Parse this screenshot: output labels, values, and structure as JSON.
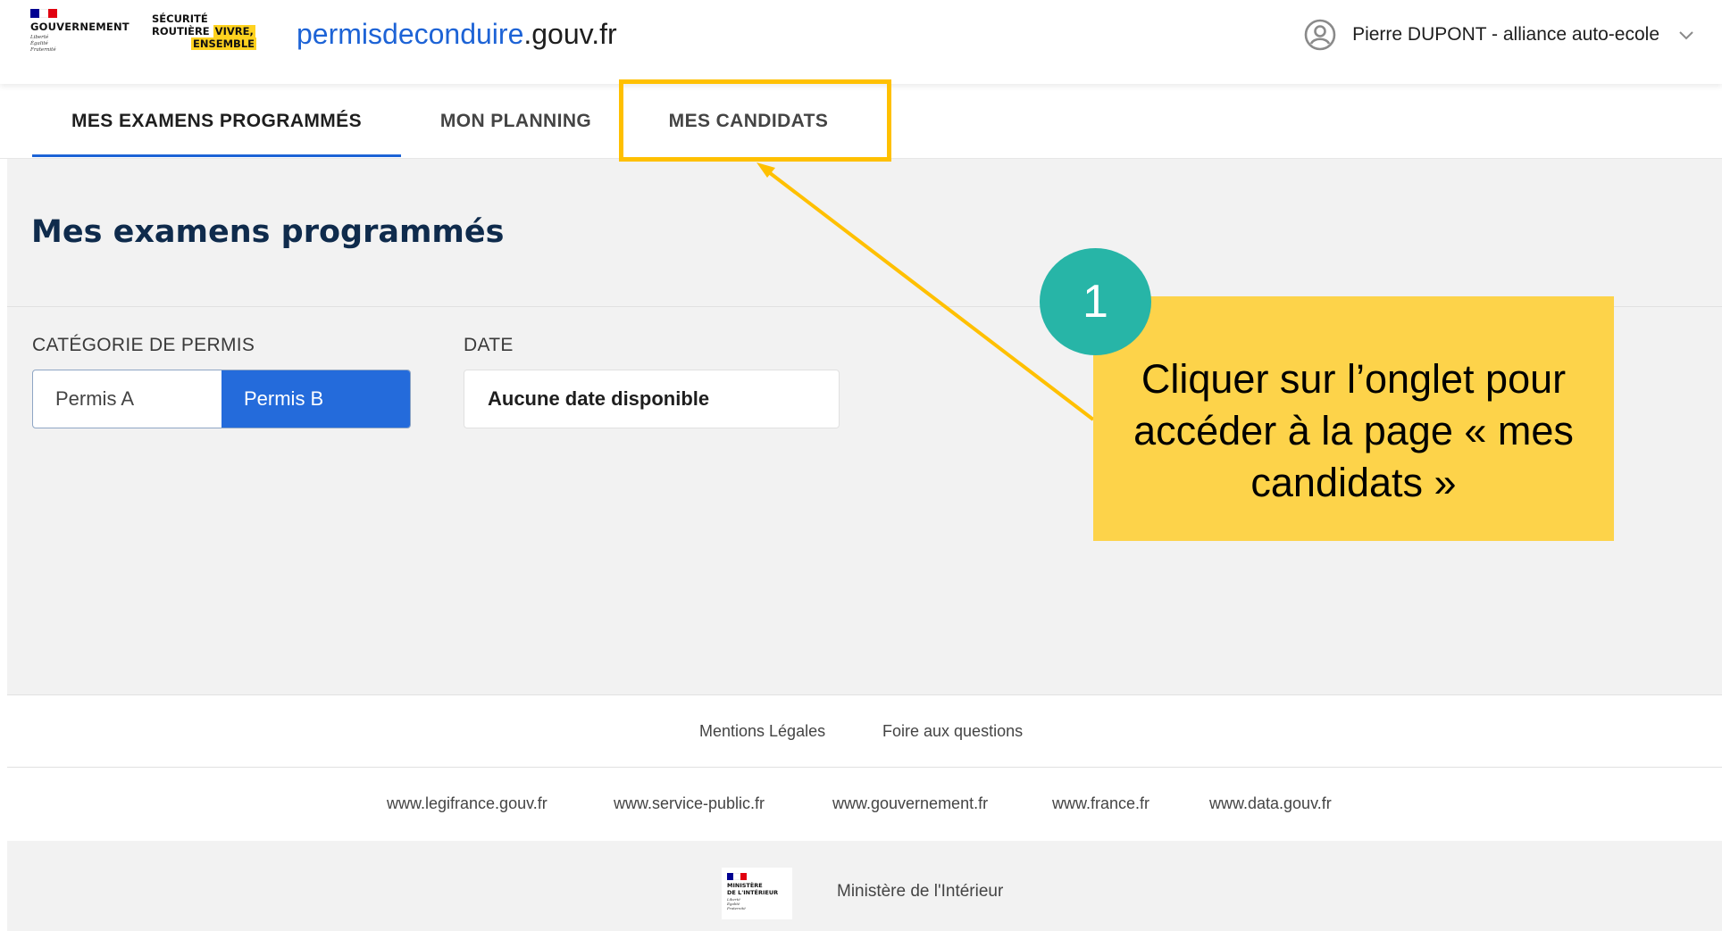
{
  "header": {
    "gov_logo_text": "GOUVERNEMENT",
    "gov_devise": [
      "Liberté",
      "Égalité",
      "Fraternité"
    ],
    "sr_logo": {
      "line1": "SÉCURITÉ",
      "line2a": "ROUTIÈRE ",
      "line2b": "VIVRE,",
      "line3": "ENSEMBLE"
    },
    "site_name_main": "permisdeconduire",
    "site_name_tld": ".gouv.fr",
    "user_label": "Pierre DUPONT - alliance auto-ecole"
  },
  "tabs": [
    {
      "label": "MES EXAMENS PROGRAMMÉS",
      "active": true
    },
    {
      "label": "MON PLANNING",
      "active": false
    },
    {
      "label": "MES CANDIDATS",
      "active": false
    }
  ],
  "main": {
    "title": "Mes examens programmés",
    "category_label": "CATÉGORIE DE PERMIS",
    "category_options": [
      "Permis A",
      "Permis B"
    ],
    "category_selected": "Permis B",
    "date_label": "DATE",
    "date_value": "Aucune date disponible"
  },
  "footer": {
    "links_row1": [
      "Mentions Légales",
      "Foire aux questions"
    ],
    "links_row2": [
      "www.legifrance.gouv.fr",
      "www.service-public.fr",
      "www.gouvernement.fr",
      "www.france.fr",
      "www.data.gouv.fr"
    ],
    "ministry_logo_text": [
      "MINISTÈRE",
      "DE L'INTÉRIEUR"
    ],
    "ministry_devise": [
      "Liberté",
      "Égalité",
      "Fraternité"
    ],
    "ministry_label": "Ministère de l'Intérieur"
  },
  "annotation": {
    "step_number": "1",
    "callout_text": "Cliquer sur l’onglet pour accéder à la page « mes candidats »"
  },
  "colors": {
    "brand_blue": "#1d63d6",
    "title_navy": "#0f2b4c",
    "highlight": "#ffc000",
    "callout_bg": "#fdd34a",
    "step_circle": "#27b5a7",
    "flag_blue": "#000091",
    "flag_red": "#e1000f"
  }
}
